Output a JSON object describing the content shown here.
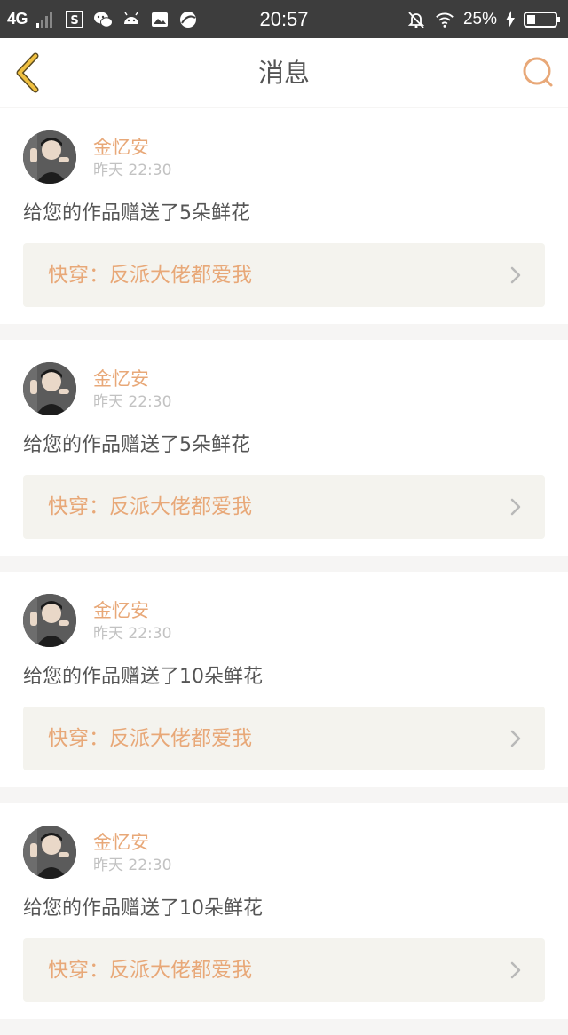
{
  "status_bar": {
    "network": "4G",
    "time": "20:57",
    "battery_percent": "25%",
    "icons": [
      "signal-icon",
      "s-app-icon",
      "wechat-icon",
      "android-icon",
      "gallery-icon",
      "browser-icon",
      "mute-icon",
      "wifi-icon",
      "charging-icon",
      "battery-icon"
    ]
  },
  "header": {
    "title": "消息",
    "back_icon": "chevron-left-icon",
    "search_icon": "search-icon"
  },
  "colors": {
    "accent_orange": "#e8a878",
    "back_yellow": "#f0c040",
    "text_gray": "#555555",
    "muted_gray": "#c2c2c2",
    "link_bg": "#f4f3ee"
  },
  "messages": [
    {
      "sender": "金忆安",
      "time": "昨天  22:30",
      "text": "给您的作品赠送了5朵鲜花",
      "work_title": "快穿：反派大佬都爱我"
    },
    {
      "sender": "金忆安",
      "time": "昨天  22:30",
      "text": "给您的作品赠送了5朵鲜花",
      "work_title": "快穿：反派大佬都爱我"
    },
    {
      "sender": "金忆安",
      "time": "昨天  22:30",
      "text": "给您的作品赠送了10朵鲜花",
      "work_title": "快穿：反派大佬都爱我"
    },
    {
      "sender": "金忆安",
      "time": "昨天  22:30",
      "text": "给您的作品赠送了10朵鲜花",
      "work_title": "快穿：反派大佬都爱我"
    }
  ]
}
